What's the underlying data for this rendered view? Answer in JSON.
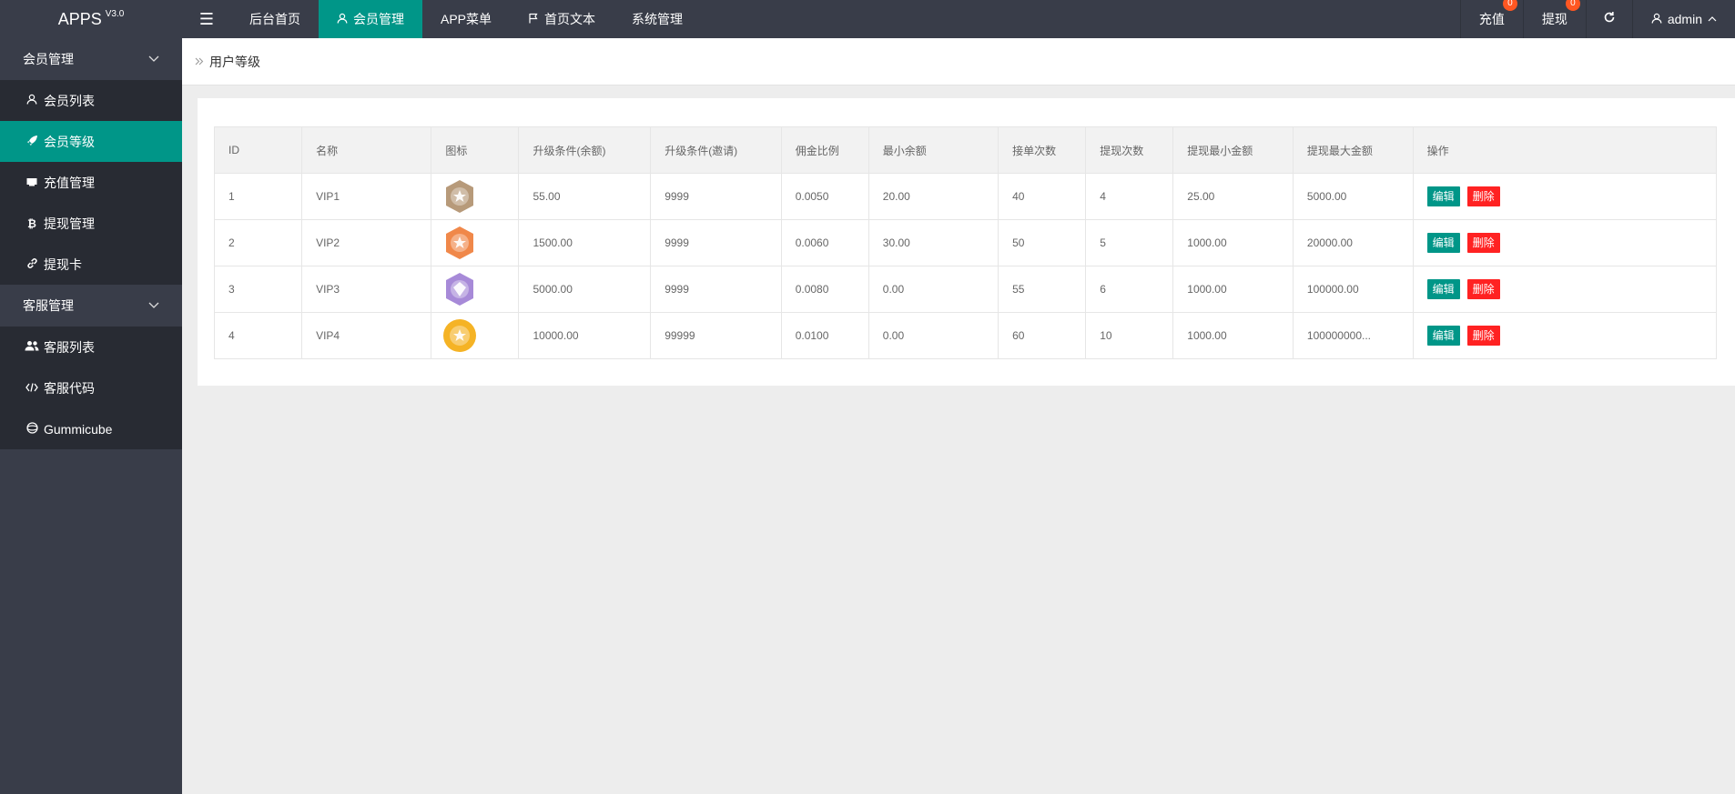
{
  "header": {
    "logo": "APPS",
    "version": "V3.0",
    "nav": [
      {
        "label": "后台首页"
      },
      {
        "label": "会员管理"
      },
      {
        "label": "APP菜单"
      },
      {
        "label": "首页文本"
      },
      {
        "label": "系统管理"
      }
    ],
    "recharge_label": "充值",
    "recharge_badge": "0",
    "withdraw_label": "提现",
    "withdraw_badge": "0",
    "admin_label": "admin"
  },
  "sidebar": {
    "groups": [
      {
        "label": "会员管理",
        "items": [
          {
            "label": "会员列表",
            "icon": "user-icon"
          },
          {
            "label": "会员等级",
            "icon": "rocket-icon"
          },
          {
            "label": "充值管理",
            "icon": "card-icon"
          },
          {
            "label": "提现管理",
            "icon": "bitcoin-icon"
          },
          {
            "label": "提现卡",
            "icon": "link-icon"
          }
        ]
      },
      {
        "label": "客服管理",
        "items": [
          {
            "label": "客服列表",
            "icon": "users-icon"
          },
          {
            "label": "客服代码",
            "icon": "code-icon"
          },
          {
            "label": "Gummicube",
            "icon": "globe-icon"
          }
        ]
      }
    ]
  },
  "breadcrumb": {
    "current": "用户等级"
  },
  "table": {
    "columns": [
      "ID",
      "名称",
      "图标",
      "升级条件(余额)",
      "升级条件(邀请)",
      "佣金比例",
      "最小余额",
      "接单次数",
      "提现次数",
      "提现最小金额",
      "提现最大金额",
      "操作"
    ],
    "rows": [
      {
        "id": "1",
        "name": "VIP1",
        "medal": "#b79a7a",
        "up_balance": "55.00",
        "up_invite": "9999",
        "rate": "0.0050",
        "min_balance": "20.00",
        "orders": "40",
        "withdraw_times": "4",
        "wd_min": "25.00",
        "wd_max": "5000.00"
      },
      {
        "id": "2",
        "name": "VIP2",
        "medal": "#f0884a",
        "up_balance": "1500.00",
        "up_invite": "9999",
        "rate": "0.0060",
        "min_balance": "30.00",
        "orders": "50",
        "withdraw_times": "5",
        "wd_min": "1000.00",
        "wd_max": "20000.00"
      },
      {
        "id": "3",
        "name": "VIP3",
        "medal": "#a78ad8",
        "up_balance": "5000.00",
        "up_invite": "9999",
        "rate": "0.0080",
        "min_balance": "0.00",
        "orders": "55",
        "withdraw_times": "6",
        "wd_min": "1000.00",
        "wd_max": "100000.00"
      },
      {
        "id": "4",
        "name": "VIP4",
        "medal": "#f5b325",
        "up_balance": "10000.00",
        "up_invite": "99999",
        "rate": "0.0100",
        "min_balance": "0.00",
        "orders": "60",
        "withdraw_times": "10",
        "wd_min": "1000.00",
        "wd_max": "100000000..."
      }
    ],
    "edit_label": "编辑",
    "delete_label": "删除"
  },
  "colors": {
    "accent": "#009688",
    "header_bg": "#393d49",
    "sidebar_sub_bg": "#282b33",
    "danger": "#ff2222",
    "badge": "#ff5722"
  }
}
